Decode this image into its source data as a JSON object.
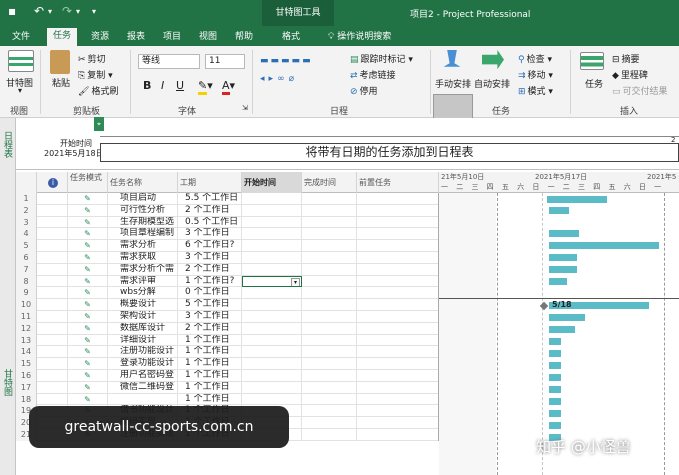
{
  "titlebar": {
    "context_tab": "甘特图工具",
    "window_title": "项目2 - Project Professional"
  },
  "tabs": [
    "文件",
    "任务",
    "资源",
    "报表",
    "项目",
    "视图",
    "帮助",
    "格式"
  ],
  "active_tab": "任务",
  "search": {
    "label": "操作说明搜索"
  },
  "ribbon": {
    "view_group": {
      "label": "视图",
      "gantt_button": "甘特图"
    },
    "clipboard_group": {
      "label": "剪贴板",
      "paste": "粘贴",
      "cut": "剪切",
      "copy": "复制",
      "format_painter": "格式刷"
    },
    "font_group": {
      "label": "字体",
      "font_name": "等线",
      "font_size": "11",
      "bold": "B",
      "italic": "I",
      "underline": "U"
    },
    "schedule_group": {
      "label": "日程",
      "mark_on_track": "跟踪时标记",
      "respect_links": "考虑链接",
      "inactivate": "停用"
    },
    "tasks_group": {
      "label": "任务",
      "manual_schedule": "手动安排",
      "auto_schedule": "自动安排",
      "inspect": "检查",
      "move": "移动",
      "mode": "模式"
    },
    "insert_group": {
      "label": "插入",
      "task": "任务",
      "summary": "摘要",
      "milestone": "里程碑",
      "deliverable": "可交付结果"
    }
  },
  "timeline": {
    "side_label": "日程表",
    "start_label": "开始时间",
    "start_date": "2021年5月18日",
    "placeholder": "将带有日期的任务添加到日程表",
    "right_edge_digits": "2"
  },
  "gantt_side_label": "甘特图",
  "columns": {
    "indicator": "i",
    "mode": "任务模式",
    "name": "任务名称",
    "duration": "工期",
    "start": "开始时间",
    "finish": "完成时间",
    "predecessors": "前置任务"
  },
  "tasks": [
    {
      "id": "1",
      "name": "项目启动",
      "duration": "5.5 个工作日"
    },
    {
      "id": "2",
      "name": "可行性分析",
      "duration": "2 个工作日"
    },
    {
      "id": "3",
      "name": "生存期模型选",
      "duration": "0.5 个工作日"
    },
    {
      "id": "4",
      "name": "项目章程编制",
      "duration": "3 个工作日"
    },
    {
      "id": "5",
      "name": "需求分析",
      "duration": "6 个工作日?"
    },
    {
      "id": "6",
      "name": "需求获取",
      "duration": "3 个工作日"
    },
    {
      "id": "7",
      "name": "需求分析个需",
      "duration": "2 个工作日"
    },
    {
      "id": "8",
      "name": "需求评审",
      "duration": "1 个工作日?"
    },
    {
      "id": "9",
      "name": "wbs分解",
      "duration": "0 个工作日"
    },
    {
      "id": "10",
      "name": "概要设计",
      "duration": "5 个工作日"
    },
    {
      "id": "11",
      "name": "架构设计",
      "duration": "3 个工作日"
    },
    {
      "id": "12",
      "name": "数据库设计",
      "duration": "2 个工作日"
    },
    {
      "id": "13",
      "name": "详细设计",
      "duration": "1 个工作日"
    },
    {
      "id": "14",
      "name": "注册功能设计",
      "duration": "1 个工作日"
    },
    {
      "id": "15",
      "name": "登录功能设计",
      "duration": "1 个工作日"
    },
    {
      "id": "16",
      "name": "用户名密码登",
      "duration": "1 个工作日"
    },
    {
      "id": "17",
      "name": "微信二维码登",
      "duration": "1 个工作日"
    },
    {
      "id": "18",
      "name": "",
      "duration": "1 个工作日"
    },
    {
      "id": "19",
      "name": "借书功能设计",
      "duration": "1 个工作日"
    },
    {
      "id": "20",
      "name": "编码实现",
      "duration": "1 个工作日"
    },
    {
      "id": "21",
      "name": "注册功能实现",
      "duration": "1 个工作日"
    }
  ],
  "gantt": {
    "week1": "21年5月10日",
    "week2": "2021年5月17日",
    "week3": "2021年5",
    "days": "一 二 三 四 五 六 日 一 二 三 四 五 六 日 一",
    "milestone_label": "5/18"
  },
  "watermarks": {
    "site": "greatwall-cc-sports.com.cn",
    "zhihu": "知乎 @小怪兽"
  }
}
